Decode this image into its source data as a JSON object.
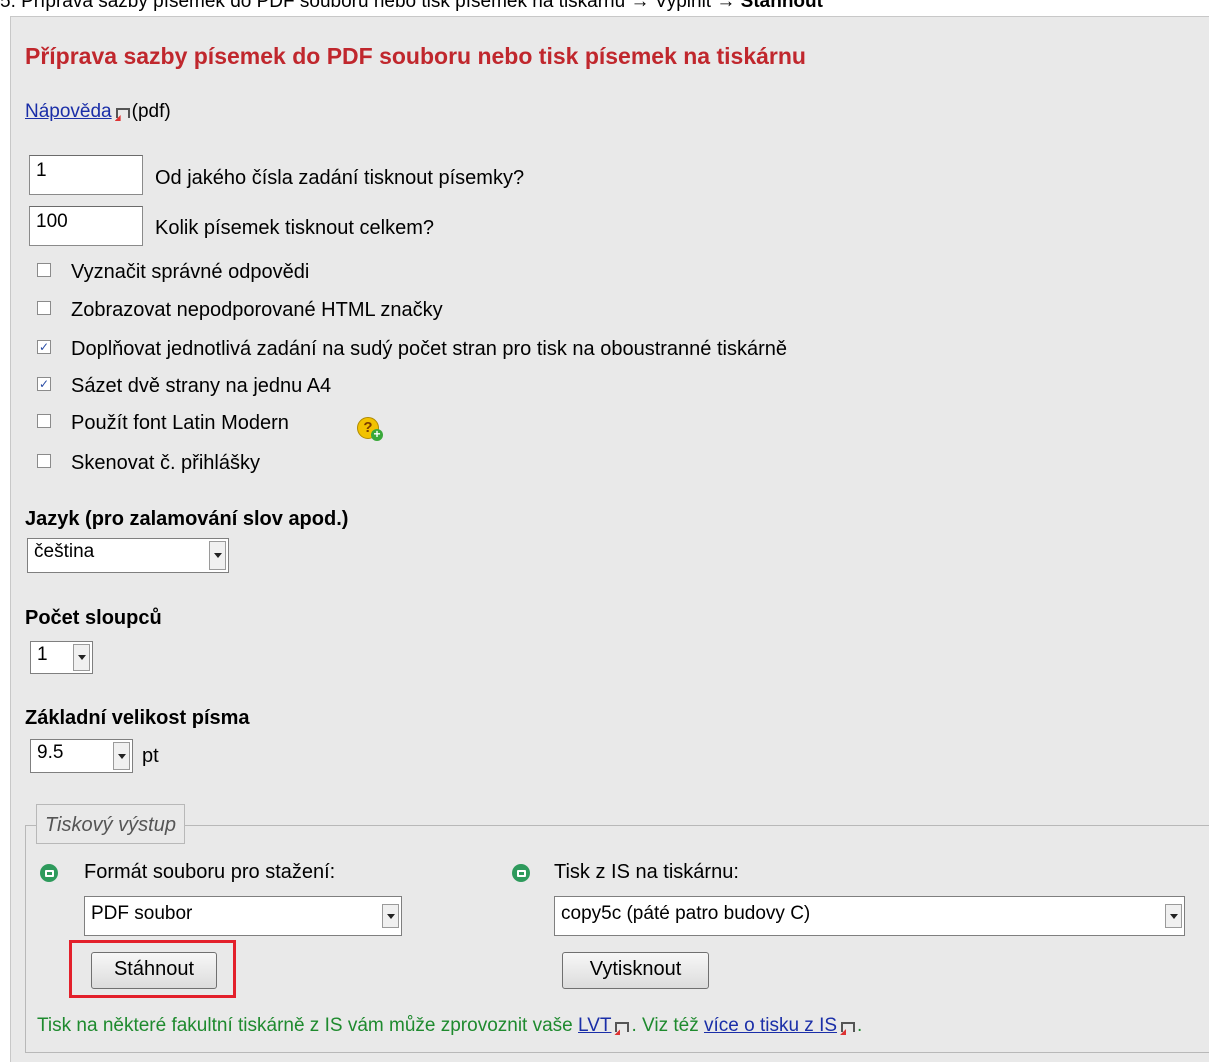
{
  "caption": {
    "prefix": "5. Příprava sazby písemek do PDF souboru nebo tisk písemek na tiskárnu → Vyplnit → ",
    "action": "Stáhnout"
  },
  "heading": "Příprava sazby písemek do PDF souboru nebo tisk písemek na tiskárnu",
  "help": {
    "link": "Nápověda",
    "suffix": "(pdf)"
  },
  "inputs": [
    {
      "value": "1",
      "label": "Od jakého čísla zadání tisknout písemky?"
    },
    {
      "value": "100",
      "label": "Kolik písemek tisknout celkem?"
    }
  ],
  "options": [
    {
      "label": "Vyznačit správné odpovědi",
      "checked": false
    },
    {
      "label": "Zobrazovat nepodporované HTML značky",
      "checked": false
    },
    {
      "label": "Doplňovat jednotlivá zadání na sudý počet stran pro tisk na oboustranné tiskárně",
      "checked": true
    },
    {
      "label": "Sázet dvě strany na jednu A4",
      "checked": true
    },
    {
      "label": "Použít font Latin Modern",
      "checked": false
    },
    {
      "label": "Skenovat č. přihlášky",
      "checked": false
    }
  ],
  "language": {
    "label": "Jazyk (pro zalamování slov apod.)",
    "selected": "čeština"
  },
  "columns": {
    "label": "Počet sloupců",
    "selected": "1"
  },
  "font_size": {
    "label": "Základní velikost písma",
    "selected": "9.5",
    "unit": "pt"
  },
  "output": {
    "legend": "Tiskový výstup",
    "download_label": "Formát souboru pro stažení:",
    "download_format": "PDF soubor",
    "download_button": "Stáhnout",
    "print_label": "Tisk z IS na tiskárnu:",
    "printer": "copy5c (páté patro budovy C)",
    "print_button": "Vytisknout"
  },
  "note": {
    "text1": "Tisk na některé fakultní tiskárně z IS vám může zprovoznit vaše ",
    "link1": "LVT",
    "text2": ". Viz též ",
    "link2": "více o tisku z IS",
    "text3": "."
  },
  "colors": {
    "heading": "#c0272d",
    "note": "#1e8a2e",
    "highlight": "#e3202b",
    "link": "#1a2ea8"
  }
}
